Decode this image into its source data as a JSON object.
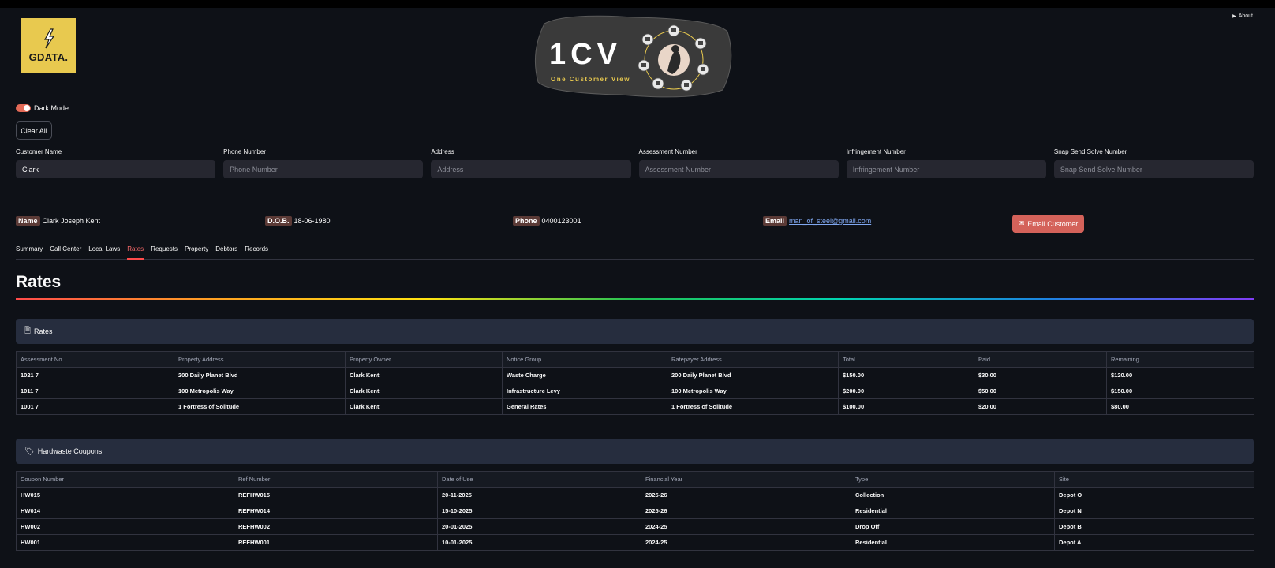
{
  "header": {
    "logo_text": "GDATA.",
    "banner_title": "1CV",
    "banner_subtitle": "One Customer View",
    "about_label": "About"
  },
  "settings": {
    "dark_mode_label": "Dark Mode",
    "dark_mode_on": true,
    "clear_all_label": "Clear All"
  },
  "search": {
    "fields": [
      {
        "label": "Customer Name",
        "value": "Clark",
        "placeholder": "Customer Name"
      },
      {
        "label": "Phone Number",
        "value": "",
        "placeholder": "Phone Number"
      },
      {
        "label": "Address",
        "value": "",
        "placeholder": "Address"
      },
      {
        "label": "Assessment Number",
        "value": "",
        "placeholder": "Assessment Number"
      },
      {
        "label": "Infringement Number",
        "value": "",
        "placeholder": "Infringement Number"
      },
      {
        "label": "Snap Send Solve Number",
        "value": "",
        "placeholder": "Snap Send Solve Number"
      }
    ]
  },
  "customer": {
    "name_key": "Name",
    "name": "Clark Joseph Kent",
    "dob_key": "D.O.B.",
    "dob": "18-06-1980",
    "phone_key": "Phone",
    "phone": "0400123001",
    "email_key": "Email",
    "email": "man_of_steel@gmail.com",
    "email_button": "Email Customer"
  },
  "tabs": [
    "Summary",
    "Call Center",
    "Local Laws",
    "Rates",
    "Requests",
    "Property",
    "Debtors",
    "Records"
  ],
  "active_tab": "Rates",
  "page_title": "Rates",
  "rates": {
    "header": "Rates",
    "columns": [
      "Assessment No.",
      "Property Address",
      "Property Owner",
      "Notice Group",
      "Ratepayer Address",
      "Total",
      "Paid",
      "Remaining"
    ],
    "rows": [
      [
        "1021 7",
        "200 Daily Planet Blvd",
        "Clark Kent",
        "Waste Charge",
        "200 Daily Planet Blvd",
        "$150.00",
        "$30.00",
        "$120.00"
      ],
      [
        "1011 7",
        "100 Metropolis Way",
        "Clark Kent",
        "Infrastructure Levy",
        "100 Metropolis Way",
        "$200.00",
        "$50.00",
        "$150.00"
      ],
      [
        "1001 7",
        "1 Fortress of Solitude",
        "Clark Kent",
        "General Rates",
        "1 Fortress of Solitude",
        "$100.00",
        "$20.00",
        "$80.00"
      ]
    ]
  },
  "coupons": {
    "header": "Hardwaste Coupons",
    "columns": [
      "Coupon Number",
      "Ref Number",
      "Date of Use",
      "Financial Year",
      "Type",
      "Site"
    ],
    "rows": [
      [
        "HW015",
        "REFHW015",
        "20-11-2025",
        "2025-26",
        "Collection",
        "Depot O"
      ],
      [
        "HW014",
        "REFHW014",
        "15-10-2025",
        "2025-26",
        "Residential",
        "Depot N"
      ],
      [
        "HW002",
        "REFHW002",
        "20-01-2025",
        "2024-25",
        "Drop Off",
        "Depot B"
      ],
      [
        "HW001",
        "REFHW001",
        "10-01-2025",
        "2024-25",
        "Residential",
        "Depot A"
      ]
    ]
  },
  "colors": {
    "background": "#0e1117",
    "accent": "#ff4b4b",
    "logo_yellow": "#e8c94f",
    "email_button": "#d4625a",
    "section_header_bg": "#262d3e"
  }
}
